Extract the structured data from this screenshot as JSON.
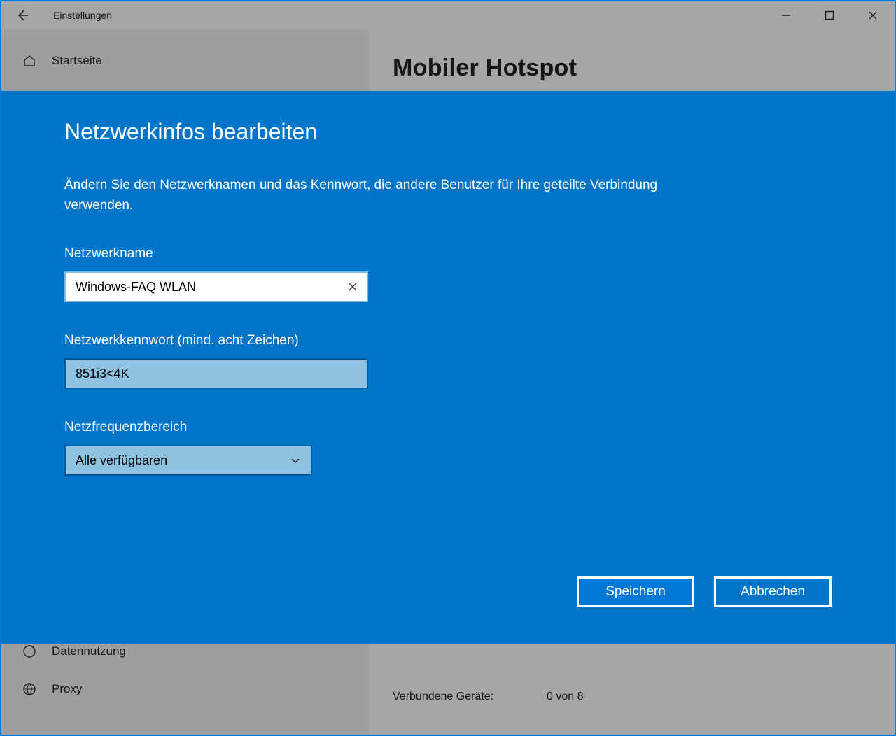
{
  "titlebar": {
    "app_title": "Einstellungen"
  },
  "sidebar": {
    "home": "Startseite",
    "data_usage": "Datennutzung",
    "proxy": "Proxy"
  },
  "main": {
    "page_title": "Mobiler Hotspot",
    "connected_label": "Verbundene Geräte:",
    "connected_value": "0 von 8"
  },
  "modal": {
    "title": "Netzwerkinfos bearbeiten",
    "description": "Ändern Sie den Netzwerknamen und das Kennwort, die andere Benutzer für Ihre geteilte Verbindung verwenden.",
    "network_name_label": "Netzwerkname",
    "network_name_value": "Windows-FAQ WLAN",
    "password_label": "Netzwerkkennwort (mind. acht Zeichen)",
    "password_value": "851i3<4K",
    "band_label": "Netzfrequenzbereich",
    "band_value": "Alle verfügbaren",
    "save": "Speichern",
    "cancel": "Abbrechen"
  }
}
